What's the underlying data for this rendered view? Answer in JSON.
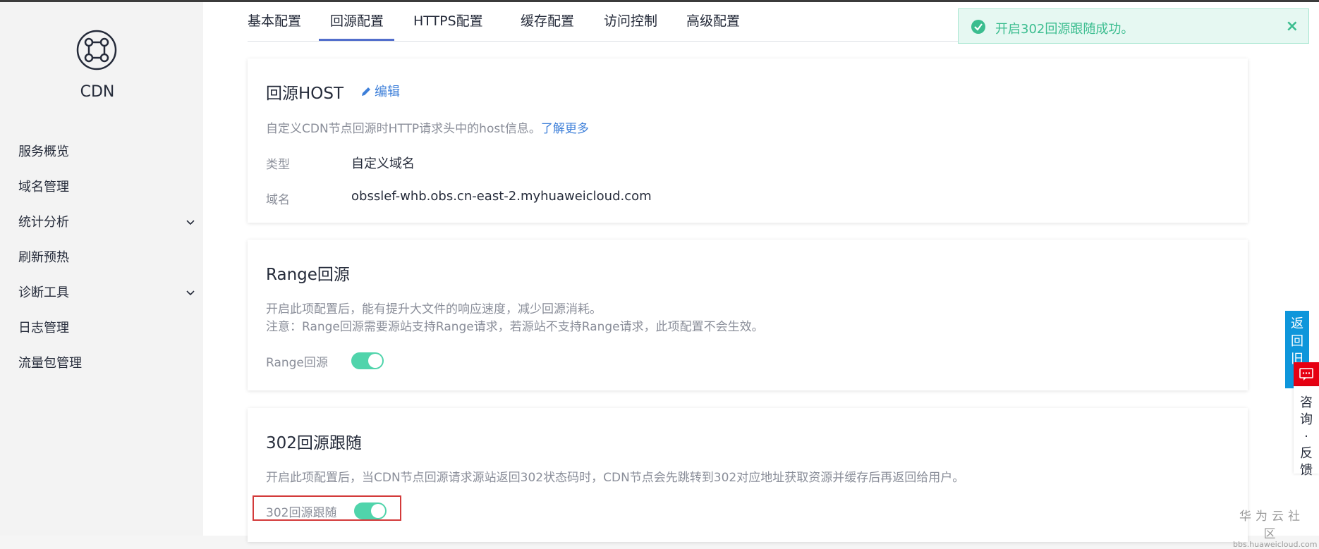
{
  "sidebar": {
    "product_name": "CDN",
    "logo_icon": "cdn-network-icon",
    "items": [
      {
        "label": "服务概览",
        "expandable": false
      },
      {
        "label": "域名管理",
        "expandable": false
      },
      {
        "label": "统计分析",
        "expandable": true
      },
      {
        "label": "刷新预热",
        "expandable": false
      },
      {
        "label": "诊断工具",
        "expandable": true
      },
      {
        "label": "日志管理",
        "expandable": false
      },
      {
        "label": "流量包管理",
        "expandable": false
      }
    ]
  },
  "tabs": [
    {
      "label": "基本配置"
    },
    {
      "label": "回源配置",
      "active": true
    },
    {
      "label": "HTTPS配置"
    },
    {
      "label": "缓存配置"
    },
    {
      "label": "访问控制"
    },
    {
      "label": "高级配置"
    }
  ],
  "host_card": {
    "title": "回源HOST",
    "edit_label": "编辑",
    "desc": "自定义CDN节点回源时HTTP请求头中的host信息。",
    "learn_more": "了解更多",
    "type_label": "类型",
    "type_value": "自定义域名",
    "domain_label": "域名",
    "domain_value": "obsslef-whb.obs.cn-east-2.myhuaweicloud.com"
  },
  "range_card": {
    "title": "Range回源",
    "desc1": "开启此项配置后，能有提升大文件的响应速度，减少回源消耗。",
    "desc2": "注意：Range回源需要源站支持Range请求，若源站不支持Range请求，此项配置不会生效。",
    "toggle_label": "Range回源",
    "toggle_on": true
  },
  "redirect_card": {
    "title": "302回源跟随",
    "desc": "开启此项配置后，当CDN节点回源请求源站返回302状态码时，CDN节点会先跳转到302对应地址获取资源并缓存后再返回给用户。",
    "toggle_label": "302回源跟随",
    "toggle_on": true
  },
  "toast": {
    "message": "开启302回源跟随成功。",
    "close": "×"
  },
  "floating": {
    "back_old": "返回旧",
    "feedback": "咨询·反馈"
  },
  "watermark": {
    "main": "华为云社区",
    "sub": "bbs.huaweicloud.com"
  },
  "colors": {
    "accent": "#526ecc",
    "toggle_on": "#50d4ab",
    "link": "#3d7fd9",
    "success": "#3bbd8f",
    "highlight_border": "#d33a3a"
  }
}
